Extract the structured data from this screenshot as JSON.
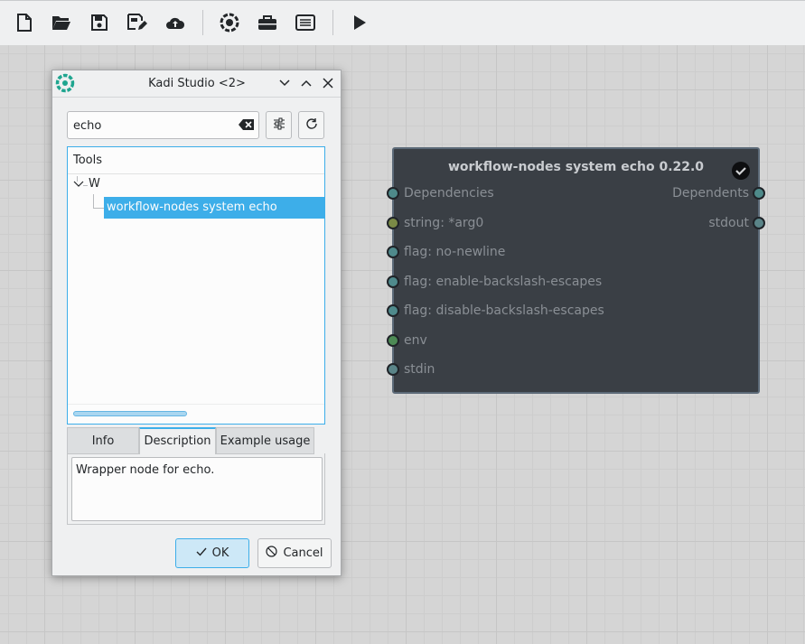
{
  "toolbar": {
    "buttons": [
      "new-file-icon",
      "open-folder-icon",
      "save-icon",
      "save-as-icon",
      "upload-cloud-icon",
      "kadi-logo-icon",
      "toolbox-icon",
      "list-icon",
      "run-icon"
    ]
  },
  "node": {
    "title": "workflow-nodes system echo 0.22.0",
    "inputs": [
      "Dependencies",
      "string: *arg0",
      "flag: no-newline",
      "flag: enable-backslash-escapes",
      "flag: disable-backslash-escapes",
      "env",
      "stdin"
    ],
    "outputs": [
      "Dependents",
      "stdout"
    ]
  },
  "dialog": {
    "title": "Kadi Studio <2>",
    "search_value": "echo",
    "tree_header": "Tools",
    "tree_group": "W",
    "tree_item": "workflow-nodes system echo",
    "tabs": [
      "Info",
      "Description",
      "Example usage"
    ],
    "active_tab": "Description",
    "description": "Wrapper node for echo.",
    "ok_label": "OK",
    "cancel_label": "Cancel"
  },
  "colors": {
    "accent": "#3daee9",
    "node_bg": "#3a3f45"
  }
}
